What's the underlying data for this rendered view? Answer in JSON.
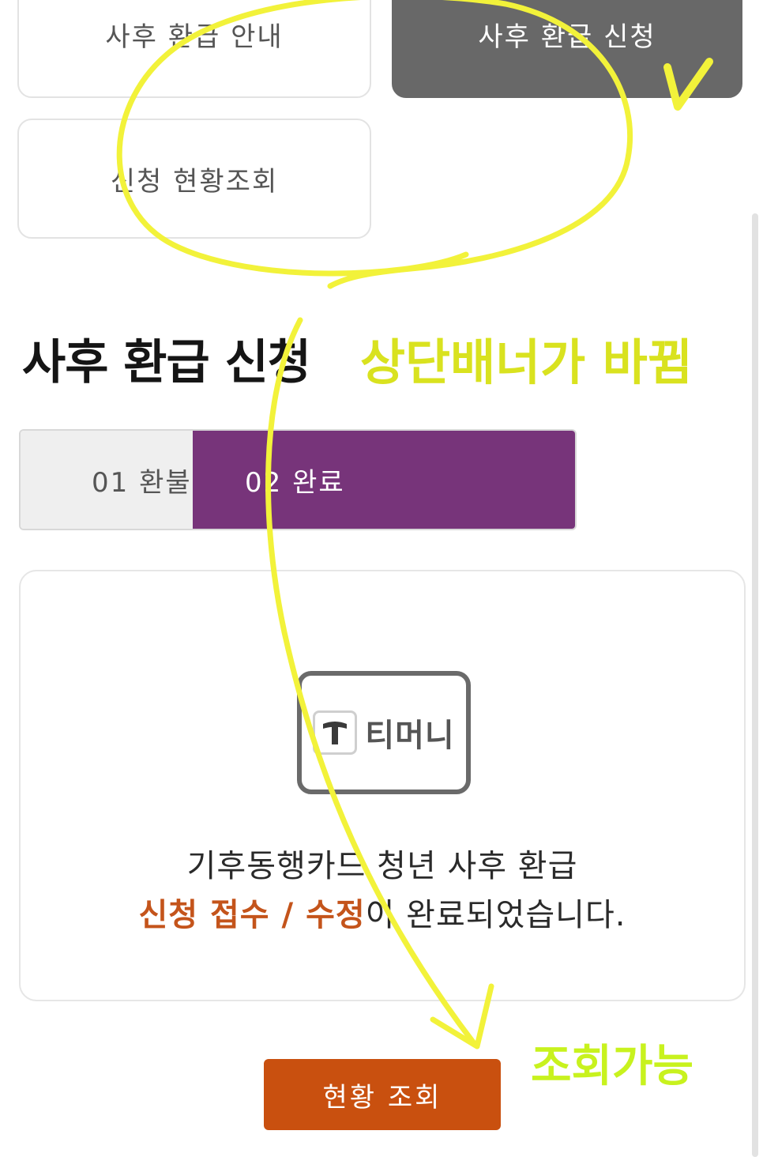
{
  "nav": {
    "refund_guide": "사후 환급 안내",
    "refund_apply": "사후 환급 신청",
    "status_inquiry": "신청 현황조회"
  },
  "page": {
    "title": "사후 환급 신청"
  },
  "steps": [
    {
      "label": "01 환불"
    },
    {
      "label": "02 완료"
    }
  ],
  "result": {
    "logo_text": "티머니",
    "line1": "기후동행카드 청년 사후 환급",
    "highlight": "신청 접수 / 수정",
    "line2_rest": "이 완료되었습니다."
  },
  "button": {
    "label": "현황 조회"
  },
  "annotations": {
    "banner_changed": "상단배너가 바뀜",
    "inquiry_possible": "조회가능"
  },
  "colors": {
    "accent_purple": "#77347a",
    "button_orange": "#c9500f",
    "highlight_orange": "#c4541b",
    "annotation_yellow": "#f2f23a",
    "annotation_yellow_text": "#d9e21f",
    "annotation_green_text": "#c8f21e"
  }
}
